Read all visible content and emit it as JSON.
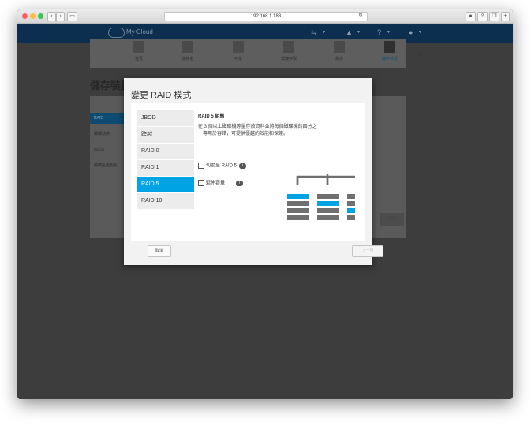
{
  "browser": {
    "url": "192.168.1.183"
  },
  "app": {
    "brand": "My Cloud"
  },
  "nav": {
    "items": [
      {
        "label": "首頁",
        "icon": "home-icon"
      },
      {
        "label": "使用者",
        "icon": "users-icon"
      },
      {
        "label": "共享",
        "icon": "shares-icon"
      },
      {
        "label": "雲端存取",
        "icon": "cloud-access-icon"
      },
      {
        "label": "備份",
        "icon": "backup-icon"
      },
      {
        "label": "儲存裝置",
        "icon": "storage-icon"
      }
    ],
    "active_index": 5
  },
  "page": {
    "title": "儲存裝置",
    "sidebar": [
      "RAID",
      "磁碟狀態",
      "iSCSI",
      "磁碟區虛擬化"
    ],
    "action_label": "設定"
  },
  "modal": {
    "title": "變更 RAID 模式",
    "raid_options": [
      "JBOD",
      "跨越",
      "RAID 0",
      "RAID 1",
      "RAID 5",
      "RAID 10"
    ],
    "selected_index": 4,
    "detail": {
      "title": "RAID 5 組態",
      "description": "在 3 個以上磁碟機等量存放資料並將每個磁碟機的四分之一專用於容錯，可提供優越的效能和保護。"
    },
    "options": [
      {
        "label": "切換至 RAID 5",
        "checked": false
      },
      {
        "label": "延伸容量",
        "checked": false
      }
    ],
    "cancel_label": "取消",
    "next_label": "下一頁"
  },
  "colors": {
    "accent": "#00a4e4",
    "topbar": "#0c2f4f",
    "disk_gray": "#6f6f6f"
  }
}
